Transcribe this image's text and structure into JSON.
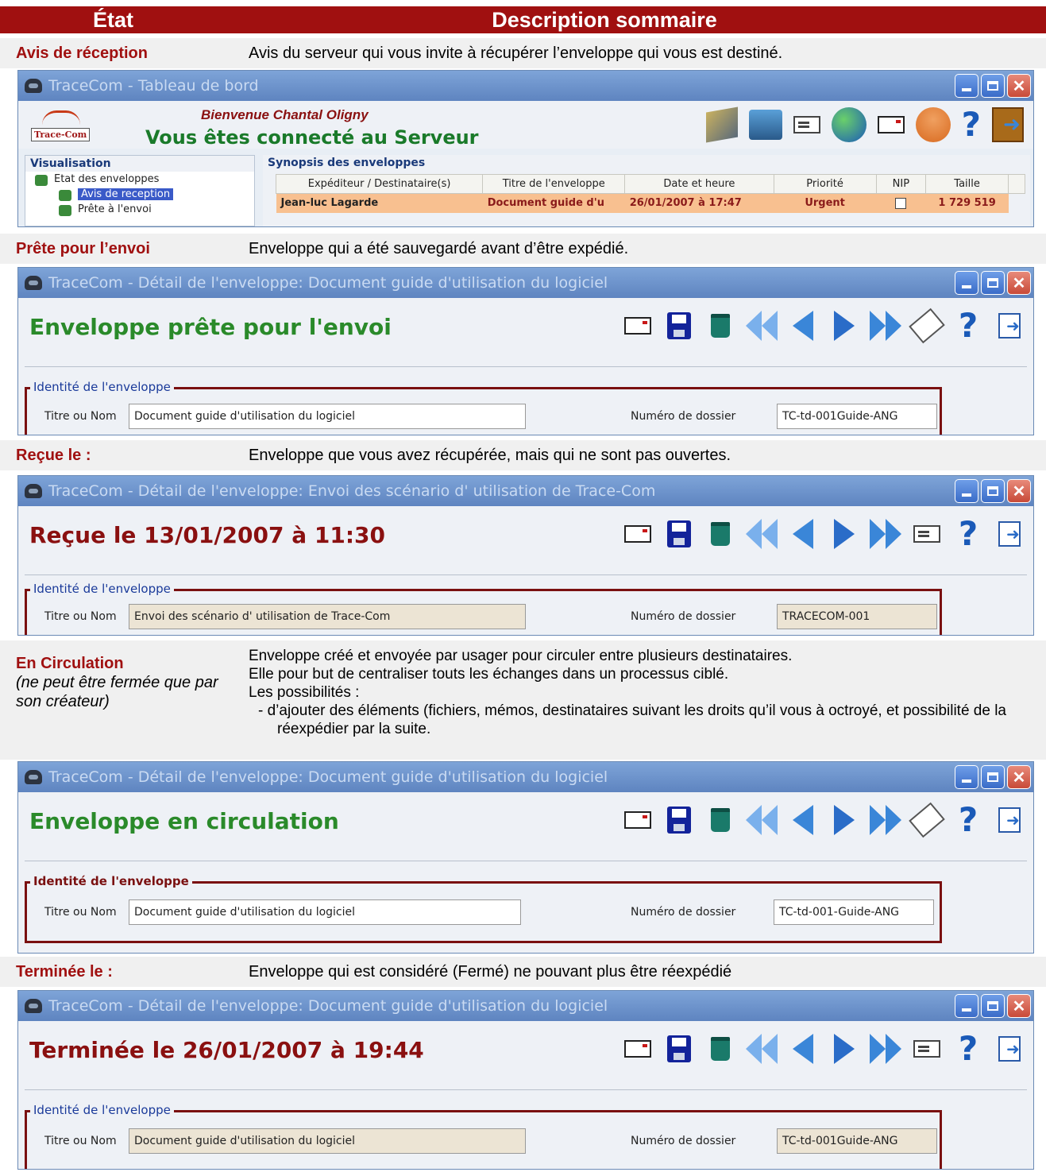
{
  "header": {
    "col1": "État",
    "col2": "Description sommaire"
  },
  "rows": {
    "avis": {
      "label": "Avis de réception",
      "desc": "Avis du serveur qui vous invite à récupérer l’enveloppe qui vous est destiné."
    },
    "prete": {
      "label": "Prête pour l’envoi",
      "desc": "Enveloppe qui a été sauvegardé avant d’être expédié."
    },
    "recue": {
      "label": "Reçue le :",
      "desc": "Enveloppe que vous avez récupérée, mais qui ne sont pas ouvertes."
    },
    "circulation": {
      "label": "En Circulation",
      "note": "(ne peut être fermée que par son créateur)",
      "lines": [
        "Enveloppe  créé et envoyée par usager pour circuler entre plusieurs destinataires.",
        "Elle pour but de centraliser touts les échanges dans un processus ciblé.",
        "Les possibilités :"
      ],
      "bullet": "-   d’ajouter des éléments (fichiers, mémos, destinataires suivant les droits qu’il vous à octroyé, et possibilité de la  réexpédier par la suite."
    },
    "terminee": {
      "label": "Terminée le :",
      "desc": "Enveloppe qui est considéré (Fermé) ne pouvant plus être réexpédié"
    }
  },
  "dashboard": {
    "title": "TraceCom - Tableau de bord",
    "logo_text": "Trace-Com",
    "welcome": "Bienvenue  Chantal Oligny",
    "connected": "Vous êtes connecté au Serveur",
    "vis_title": "Visualisation",
    "tree": [
      "Etat des enveloppes",
      "Avis de reception",
      "Prête à l'envoi"
    ],
    "synopsis_title": "Synopsis des enveloppes",
    "columns": [
      "Expéditeur / Destinataire(s)",
      "Titre de l'enveloppe",
      "Date et heure",
      "Priorité",
      "NIP",
      "Taille"
    ],
    "row": [
      "Jean-luc Lagarde",
      "Document guide d'u",
      "26/01/2007 à 17:47",
      "Urgent",
      "",
      "1 729 519"
    ]
  },
  "windows": {
    "prete": {
      "title": "TraceCom -  Détail de l'enveloppe: Document guide d'utilisation du logiciel",
      "heading": "Enveloppe prête pour l'envoi",
      "group": "Identité de l'enveloppe",
      "title_label": "Titre ou Nom",
      "title_value": "Document guide d'utilisation du logiciel",
      "folder_label": "Numéro de dossier",
      "folder_value": "TC-td-001Guide-ANG"
    },
    "recue": {
      "title": "TraceCom -  Détail de l'enveloppe: Envoi des scénario d' utilisation de Trace-Com",
      "heading": "Reçue le 13/01/2007 à 11:30",
      "group": "Identité de l'enveloppe",
      "title_label": "Titre ou Nom",
      "title_value": "Envoi des scénario d' utilisation de Trace-Com",
      "folder_label": "Numéro de dossier",
      "folder_value": "TRACECOM-001"
    },
    "circulation": {
      "title": "TraceCom -  Détail de l'enveloppe: Document guide d'utilisation du logiciel",
      "heading": "Enveloppe en circulation",
      "group": "Identité de l'enveloppe",
      "title_label": "Titre ou Nom",
      "title_value": "Document guide d'utilisation du logiciel",
      "folder_label": "Numéro de dossier",
      "folder_value": "TC-td-001-Guide-ANG"
    },
    "terminee": {
      "title": "TraceCom -  Détail de l'enveloppe: Document guide d'utilisation du logiciel",
      "heading": "Terminée le 26/01/2007 à 19:44",
      "group": "Identité de l'enveloppe",
      "title_label": "Titre ou Nom",
      "title_value": "Document guide d'utilisation du logiciel",
      "folder_label": "Numéro de dossier",
      "folder_value": "TC-td-001Guide-ANG"
    }
  },
  "icons": [
    "envelope-icon",
    "save-icon",
    "trash-icon",
    "first-icon",
    "previous-icon",
    "next-icon",
    "last-icon",
    "sign-icon",
    "help-icon",
    "exit-icon"
  ],
  "colors": {
    "header": "#a01010",
    "label": "#a01010",
    "title_green": "#2a8a2a",
    "title_red": "#8a1010",
    "frame": "#7a1010"
  }
}
